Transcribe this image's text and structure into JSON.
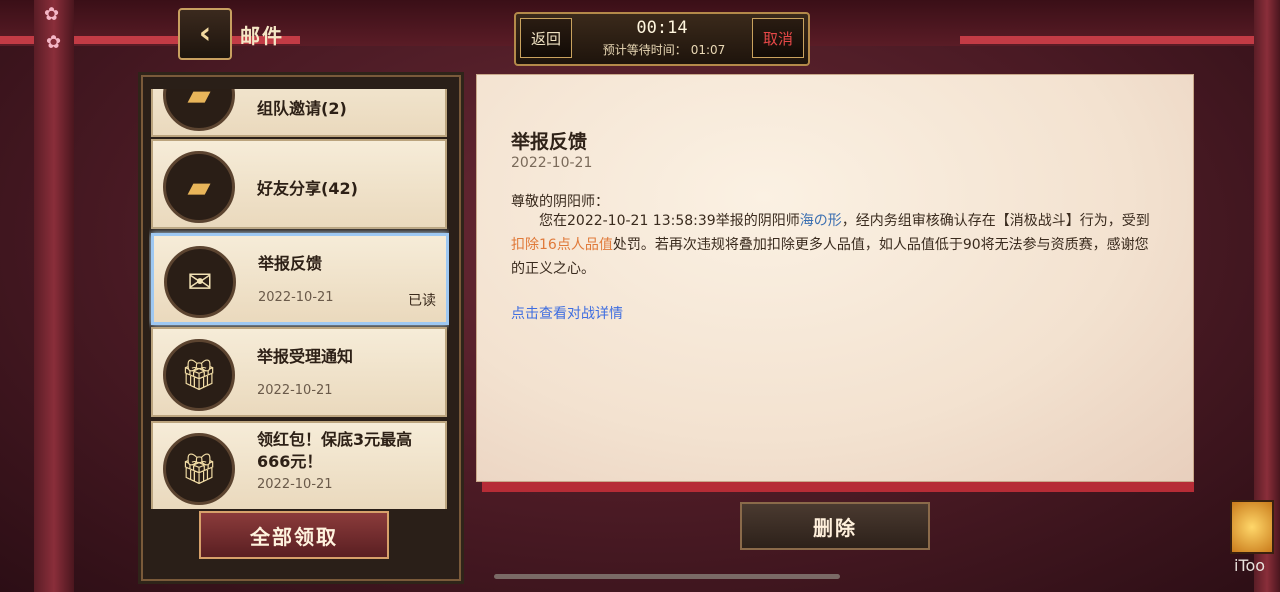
{
  "header": {
    "back_icon": "chevron-left-icon",
    "title": "邮件"
  },
  "queue": {
    "back_label": "返回",
    "timer": "00:14",
    "wait_label": "预计等待时间：",
    "wait_time": "01:07",
    "cancel_label": "取消"
  },
  "mail_list": {
    "items": [
      {
        "name": "组队邀请(2)",
        "icon": "chat-bubble-icon",
        "date": "",
        "state": ""
      },
      {
        "name": "好友分享(42)",
        "icon": "chat-bubble-icon",
        "date": "",
        "state": ""
      },
      {
        "name": "举报反馈",
        "icon": "open-envelope-icon",
        "date": "2022-10-21",
        "state": "已读"
      },
      {
        "name": "举报受理通知",
        "icon": "ribbon-package-icon",
        "date": "2022-10-21",
        "state": ""
      },
      {
        "name": "领红包！保底3元最高666元！",
        "icon": "ribbon-package-icon",
        "date": "2022-10-21",
        "state": ""
      }
    ],
    "claim_all_label": "全部领取"
  },
  "detail": {
    "title": "举报反馈",
    "date": "2022-10-21",
    "greeting": "尊敬的阴阳师：",
    "body_part1": "您在2022-10-21 13:58:39举报的阴阳师",
    "reported_name": "海の形",
    "body_part2": "，经内务组审核确认存在【消极战斗】行为，受到",
    "penalty": "扣除16点人品值",
    "body_part3": "处罚。若再次违规将叠加扣除更多人品值，如人品值低于90将无法参与资质赛，感谢您的正义之心。",
    "link": "点击查看对战详情"
  },
  "delete_label": "删除",
  "watermark": "iToo",
  "colors": {
    "accent_red": "#b62c36",
    "link_blue": "#3f6ee0",
    "penalty_orange": "#e07a3a",
    "cancel_red": "#e74848"
  }
}
